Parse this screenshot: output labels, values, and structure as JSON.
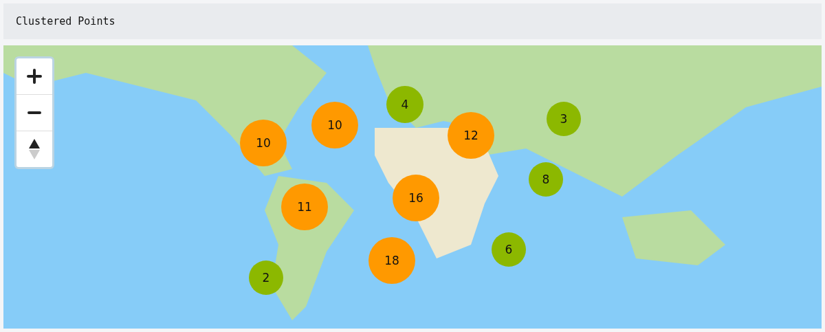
{
  "header": {
    "title": "Clustered Points"
  },
  "map": {
    "clusters": [
      {
        "count": "10",
        "color": "#ff9900"
      },
      {
        "count": "10",
        "color": "#ff9900"
      },
      {
        "count": "4",
        "color": "#8cb800"
      },
      {
        "count": "12",
        "color": "#ff9900"
      },
      {
        "count": "3",
        "color": "#8cb800"
      },
      {
        "count": "8",
        "color": "#8cb800"
      },
      {
        "count": "11",
        "color": "#ff9900"
      },
      {
        "count": "16",
        "color": "#ff9900"
      },
      {
        "count": "6",
        "color": "#8cb800"
      },
      {
        "count": "18",
        "color": "#ff9900"
      },
      {
        "count": "2",
        "color": "#8cb800"
      }
    ]
  }
}
